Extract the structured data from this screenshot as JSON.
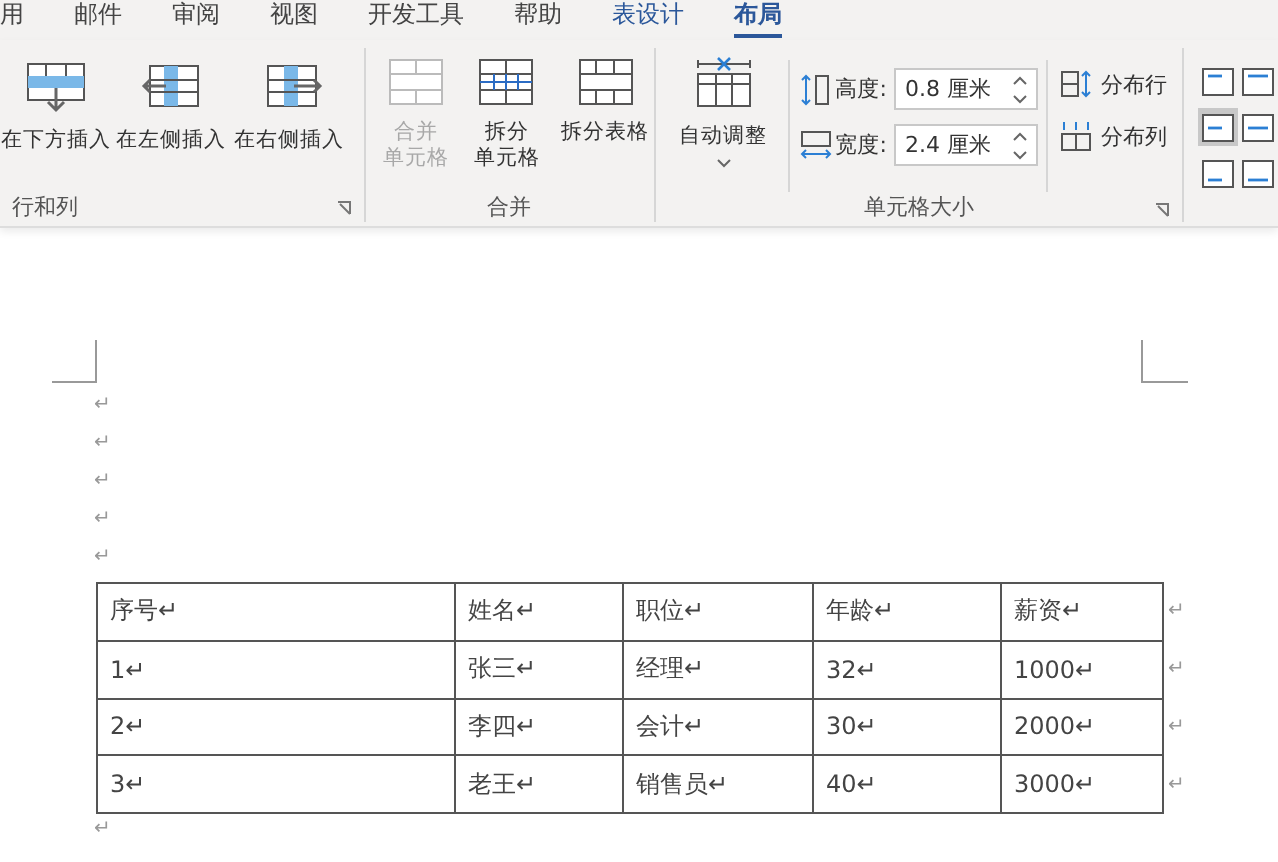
{
  "tabs": [
    {
      "label": "用",
      "selected": false,
      "contextual": false
    },
    {
      "label": "邮件",
      "selected": false,
      "contextual": false
    },
    {
      "label": "审阅",
      "selected": false,
      "contextual": false
    },
    {
      "label": "视图",
      "selected": false,
      "contextual": false
    },
    {
      "label": "开发工具",
      "selected": false,
      "contextual": false
    },
    {
      "label": "帮助",
      "selected": false,
      "contextual": false
    },
    {
      "label": "表设计",
      "selected": false,
      "contextual": true
    },
    {
      "label": "布局",
      "selected": true,
      "contextual": true
    }
  ],
  "rows_columns_group": {
    "label": "行和列",
    "buttons": [
      {
        "label": "在下方插入"
      },
      {
        "label": "在左侧插入"
      },
      {
        "label": "在右侧插入"
      }
    ]
  },
  "merge_group": {
    "label": "合并",
    "buttons": [
      {
        "lines": [
          "合并",
          "单元格"
        ],
        "disabled": true
      },
      {
        "lines": [
          "拆分",
          "单元格"
        ],
        "disabled": false
      },
      {
        "lines": [
          "拆分表格"
        ],
        "disabled": false
      }
    ]
  },
  "cell_size_group": {
    "label": "单元格大小",
    "autofit": {
      "label": "自动调整"
    },
    "height": {
      "label": "高度:",
      "value": "0.8 厘米"
    },
    "width": {
      "label": "宽度:",
      "value": "2.4 厘米"
    },
    "distribute": [
      {
        "label": "分布行"
      },
      {
        "label": "分布列"
      }
    ]
  },
  "alignment_buttons": [
    {
      "selected": false
    },
    {
      "selected": false
    },
    {
      "selected": true
    },
    {
      "selected": false
    },
    {
      "selected": false
    },
    {
      "selected": false
    }
  ],
  "document": {
    "empty_paragraphs": [
      "↵",
      "↵",
      "↵",
      "↵",
      "↵"
    ],
    "table": {
      "rows": [
        {
          "cells": [
            "序号↵",
            "姓名↵",
            "职位↵",
            "年龄↵",
            "薪资↵"
          ],
          "end_mark": "↵"
        },
        {
          "cells": [
            "1↵",
            "张三↵",
            "经理↵",
            "32↵",
            "1000↵"
          ],
          "end_mark": "↵"
        },
        {
          "cells": [
            "2↵",
            "李四↵",
            "会计↵",
            "30↵",
            "2000↵"
          ],
          "end_mark": "↵"
        },
        {
          "cells": [
            "3↵",
            "老王↵",
            "销售员↵",
            "40↵",
            "3000↵"
          ],
          "end_mark": "↵"
        }
      ]
    },
    "after_table": "↵"
  }
}
